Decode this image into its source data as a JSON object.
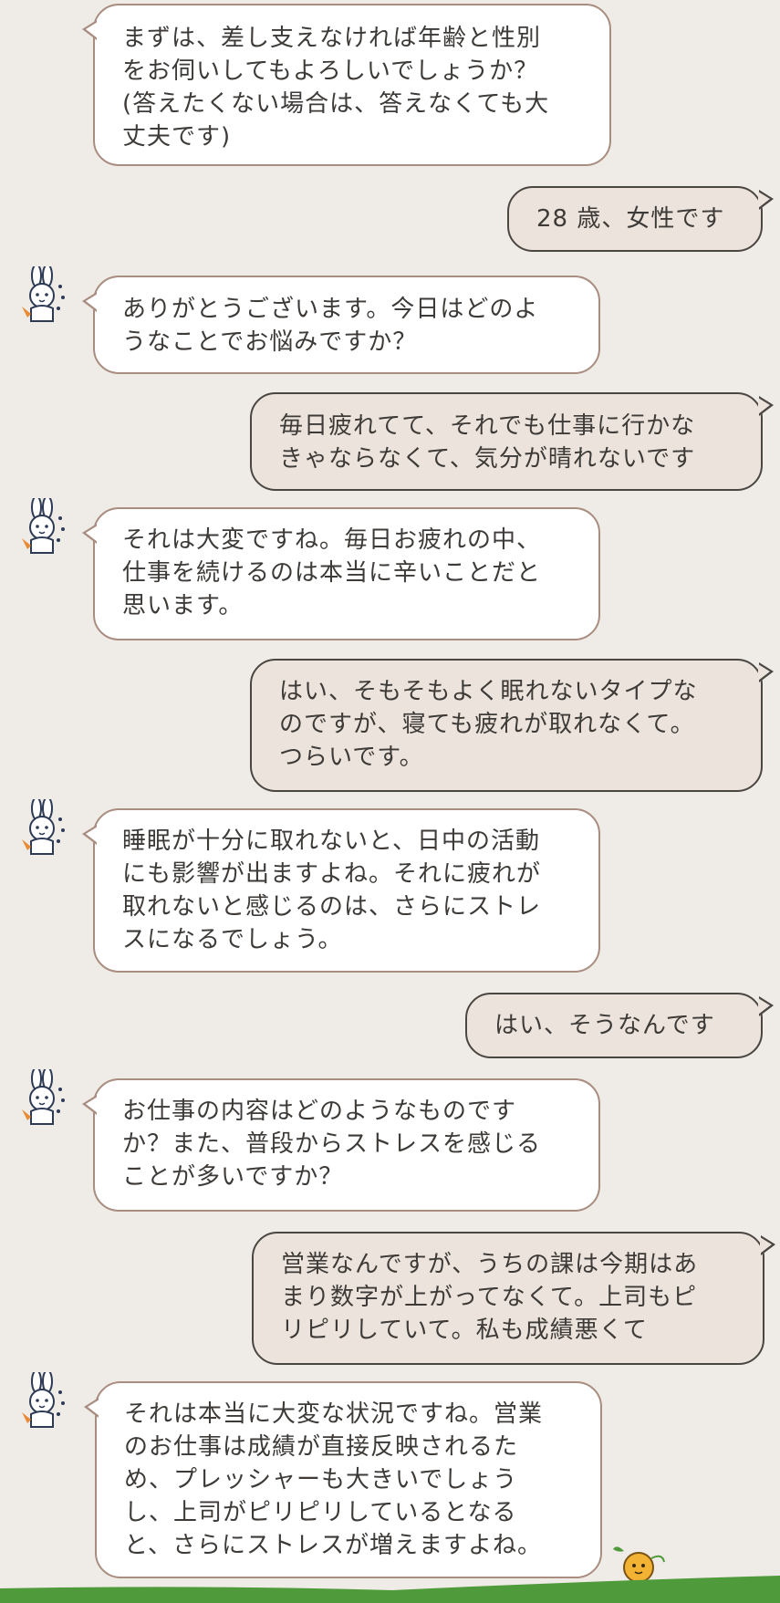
{
  "colors": {
    "background": "#efebe6",
    "bot_bubble": "#ffffff",
    "bot_border": "#a88d80",
    "user_bubble": "#ece4dc",
    "user_border": "#4a4641",
    "ground": "#4f9a3a"
  },
  "messages": [
    {
      "role": "bot",
      "text": "まずは、差し支えなければ年齢と性別\nをお伺いしてもよろしいでしょうか？\n(答えたくない場合は、答えなくても大\n丈夫です)"
    },
    {
      "role": "user",
      "text": "28 歳、女性です"
    },
    {
      "role": "bot",
      "text": "ありがとうございます。今日はどのよ\nうなことでお悩みですか？"
    },
    {
      "role": "user",
      "text": "毎日疲れてて、それでも仕事に行かな\nきゃならなくて、気分が晴れないです"
    },
    {
      "role": "bot",
      "text": "それは大変ですね。毎日お疲れの中、\n仕事を続けるのは本当に辛いことだと\n思います。"
    },
    {
      "role": "user",
      "text": "はい、そもそもよく眠れないタイプな\nのですが、寝ても疲れが取れなくて。\nつらいです。"
    },
    {
      "role": "bot",
      "text": "睡眠が十分に取れないと、日中の活動\nにも影響が出ますよね。それに疲れが\n取れないと感じるのは、さらにストレ\nスになるでしょう。"
    },
    {
      "role": "user",
      "text": "はい、そうなんです"
    },
    {
      "role": "bot",
      "text": "お仕事の内容はどのようなものです\nか？また、普段からストレスを感じる\nことが多いですか？"
    },
    {
      "role": "user",
      "text": "営業なんですが、うちの課は今期はあ\nまり数字が上がってなくて。上司もピ\nリピリしていて。私も成績悪くて"
    },
    {
      "role": "bot",
      "text": "それは本当に大変な状況ですね。営業\nのお仕事は成績が直接反映されるた\nめ、プレッシャーも大きいでしょう\nし、上司がピリピリしているとなる\nと、さらにストレスが増えますよね。"
    }
  ],
  "icons": {
    "bot_avatar": "rabbit-doctor-icon",
    "mascot": "mascot-sprout-icon"
  }
}
